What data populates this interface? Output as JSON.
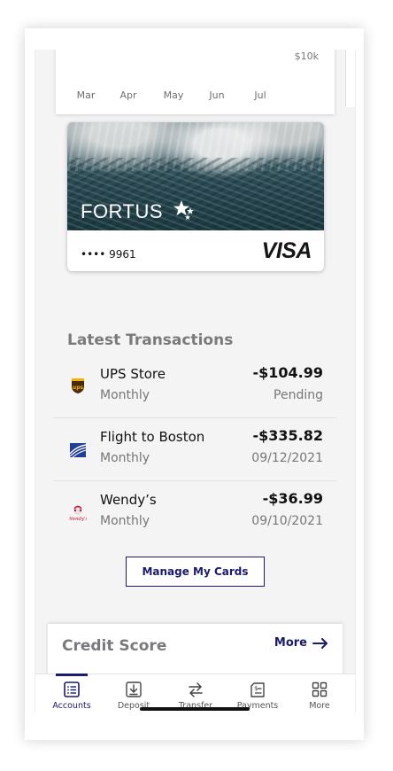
{
  "chart": {
    "y_tick": "$10k",
    "months": [
      "Mar",
      "Apr",
      "May",
      "Jun",
      "Jul"
    ]
  },
  "card": {
    "brand": "FORTUS",
    "number_masked": "•••• 9961",
    "network": "VISA"
  },
  "transactions": {
    "title": "Latest Transactions",
    "items": [
      {
        "merchant": "UPS Store",
        "frequency": "Monthly",
        "amount": "-$104.99",
        "status": "Pending",
        "logo": "ups-logo-icon"
      },
      {
        "merchant": "Flight to Boston",
        "frequency": "Monthly",
        "amount": "-$335.82",
        "status": "09/12/2021",
        "logo": "airline-logo-icon"
      },
      {
        "merchant": "Wendy’s",
        "frequency": "Monthly",
        "amount": "-$36.99",
        "status": "09/10/2021",
        "logo": "wendys-logo-icon"
      }
    ],
    "manage_button": "Manage My Cards"
  },
  "credit_score": {
    "title": "Credit Score",
    "more_label": "More"
  },
  "tabbar": {
    "items": [
      {
        "label": "Accounts",
        "icon": "accounts-icon",
        "active": true
      },
      {
        "label": "Deposit",
        "icon": "deposit-icon",
        "active": false
      },
      {
        "label": "Transfer",
        "icon": "transfer-icon",
        "active": false
      },
      {
        "label": "Payments",
        "icon": "payments-icon",
        "active": false
      },
      {
        "label": "More",
        "icon": "grid-icon",
        "active": false
      }
    ]
  },
  "colors": {
    "accent": "#1a1a6e",
    "muted_text": "#777777",
    "background": "#f4f4f5"
  }
}
